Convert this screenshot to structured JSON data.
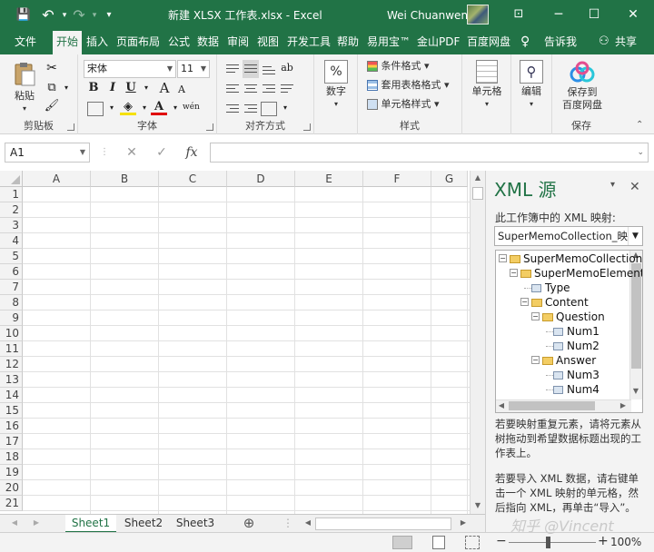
{
  "titlebar": {
    "title": "新建 XLSX 工作表.xlsx  -  Excel",
    "user": "Wei Chuanwen",
    "qat": {
      "save_icon": "💾",
      "undo_icon": "↶",
      "redo_icon": "↷",
      "customize_icon": "▾"
    },
    "window": {
      "ribbon_display_icon": "⊡",
      "minimize_icon": "─",
      "maximize_icon": "☐",
      "close_icon": "✕"
    }
  },
  "menu": {
    "tabs": [
      "文件",
      "开始",
      "插入",
      "页面布局",
      "公式",
      "数据",
      "审阅",
      "视图",
      "开发工具",
      "帮助",
      "易用宝™",
      "金山PDF",
      "百度网盘"
    ],
    "active_tab": "开始",
    "tell_me": "告诉我",
    "share": "共享"
  },
  "ribbon": {
    "clipboard": {
      "label": "剪贴板",
      "paste": "粘贴"
    },
    "font": {
      "label": "字体",
      "name": "宋体",
      "size": "11",
      "bold": "B",
      "italic": "I",
      "underline": "U",
      "grow": "A",
      "shrink": "A",
      "font_color": "A",
      "phonetic": "wén"
    },
    "alignment": {
      "label": "对齐方式"
    },
    "number": {
      "label": "数字",
      "format": "数字",
      "percent": "%"
    },
    "styles": {
      "label": "样式",
      "conditional": "条件格式",
      "table": "套用表格格式",
      "cell_styles": "单元格样式"
    },
    "cells": {
      "label": "单元格"
    },
    "editing": {
      "label": "编辑"
    },
    "save": {
      "label": "保存",
      "button": "保存到 百度网盘",
      "line1": "保存到",
      "line2": "百度网盘"
    }
  },
  "formula_bar": {
    "name_box": "A1",
    "cancel": "✕",
    "enter": "✓",
    "fx": "fx",
    "value": ""
  },
  "grid": {
    "columns": [
      "A",
      "B",
      "C",
      "D",
      "E",
      "F",
      "G"
    ],
    "rows": [
      "1",
      "2",
      "3",
      "4",
      "5",
      "6",
      "7",
      "8",
      "9",
      "10",
      "11",
      "12",
      "13",
      "14",
      "15",
      "16",
      "17",
      "18",
      "19",
      "20",
      "21"
    ]
  },
  "sheets": {
    "tabs": [
      "Sheet1",
      "Sheet2",
      "Sheet3"
    ],
    "active": "Sheet1",
    "add": "⊕"
  },
  "xml_pane": {
    "title": "XML 源",
    "close": "✕",
    "maps_label": "此工作簿中的 XML 映射:",
    "selected_map": "SuperMemoCollection_映射",
    "tree": [
      {
        "label": "SuperMemoCollection",
        "level": 0,
        "kind": "folder",
        "expander": "⊟"
      },
      {
        "label": "SuperMemoElement",
        "level": 1,
        "kind": "folder",
        "expander": "⊟"
      },
      {
        "label": "Type",
        "level": 2,
        "kind": "leaf",
        "expander": ""
      },
      {
        "label": "Content",
        "level": 2,
        "kind": "folder",
        "expander": "⊟"
      },
      {
        "label": "Question",
        "level": 3,
        "kind": "folder",
        "expander": "⊟"
      },
      {
        "label": "Num1",
        "level": 4,
        "kind": "leaf",
        "expander": ""
      },
      {
        "label": "Num2",
        "level": 4,
        "kind": "leaf",
        "expander": ""
      },
      {
        "label": "Answer",
        "level": 3,
        "kind": "folder",
        "expander": "⊟"
      },
      {
        "label": "Num3",
        "level": 4,
        "kind": "leaf",
        "expander": ""
      },
      {
        "label": "Num4",
        "level": 4,
        "kind": "leaf",
        "expander": ""
      }
    ],
    "hint1": "若要映射重复元素，请将元素从树拖动到希望数据标题出现的工作表上。",
    "hint2": "若要导入 XML 数据，请右键单击一个 XML 映射的单元格，然后指向 XML，再单击“导入”。"
  },
  "status": {
    "zoom": "100%",
    "zoom_out": "−",
    "zoom_in": "+"
  },
  "watermark": "知乎 @Vincent",
  "colors": {
    "accent": "#217346",
    "ribbon_bg": "#f3f3f3",
    "grid_line": "#e1e1e1"
  }
}
